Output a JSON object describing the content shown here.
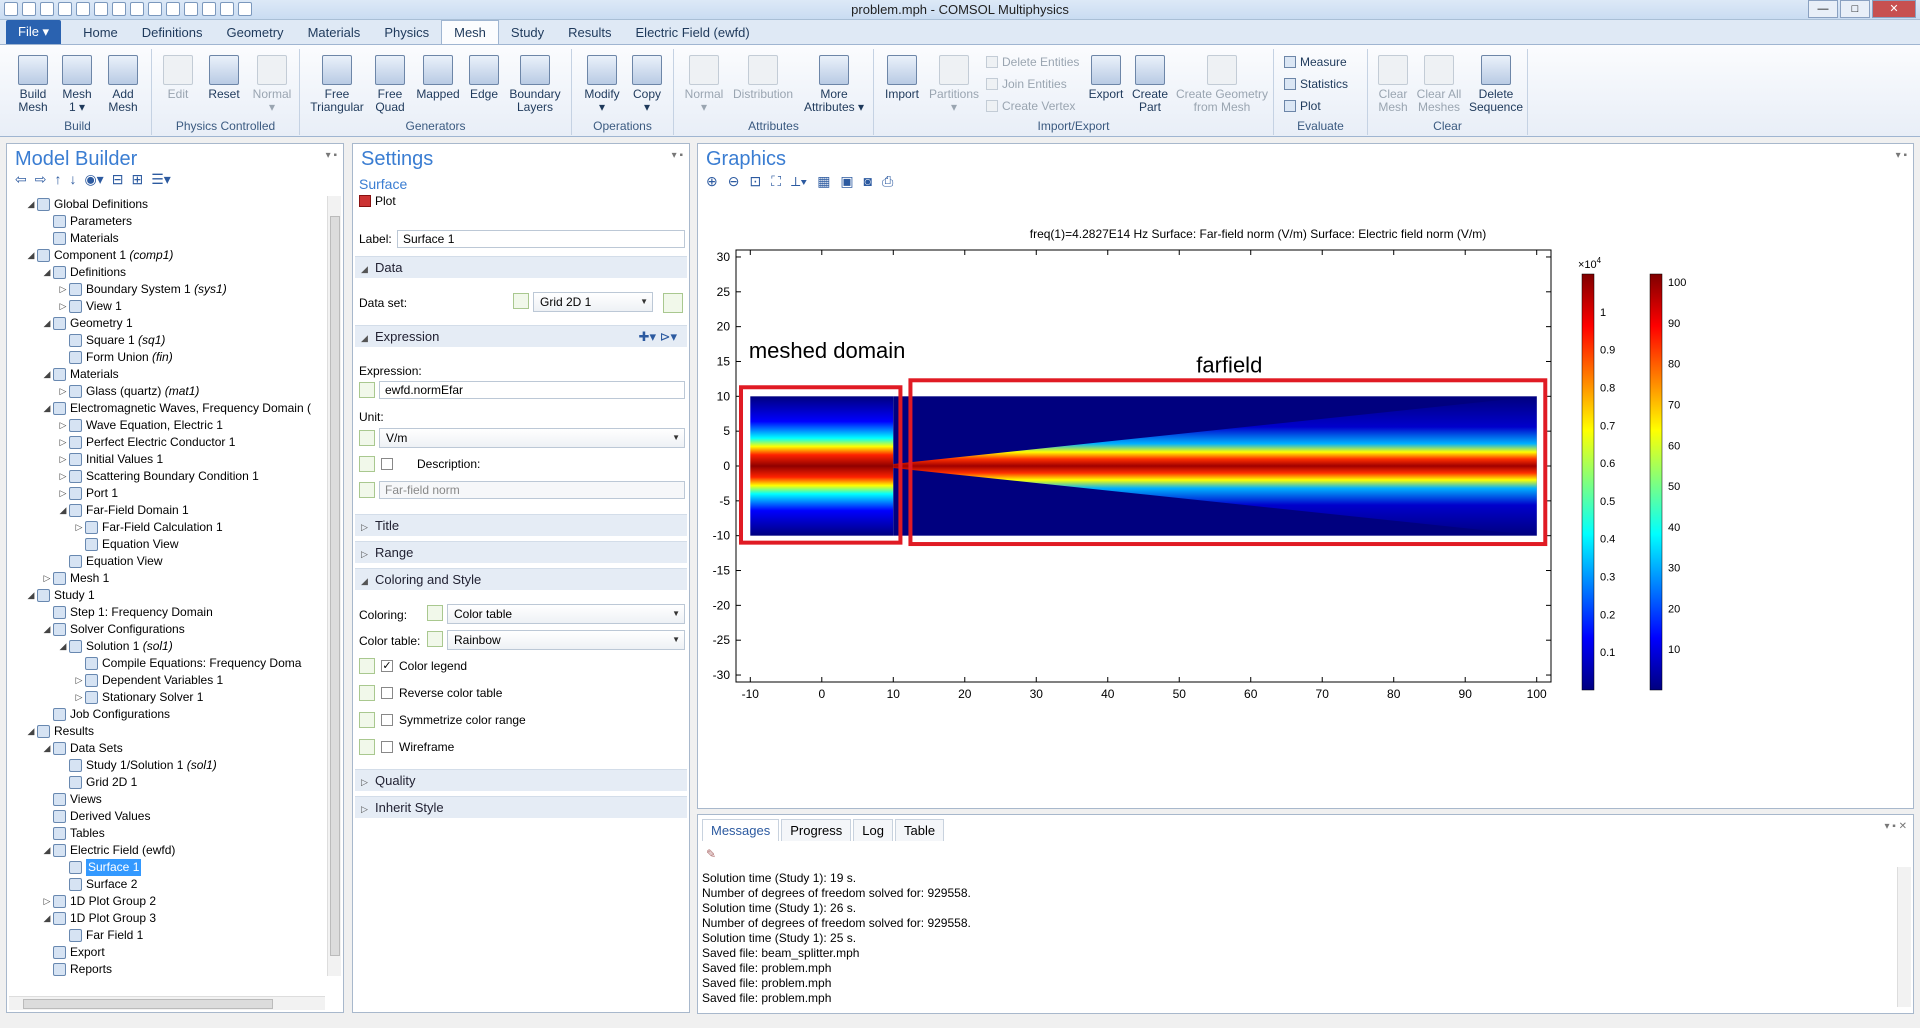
{
  "window": {
    "title": "problem.mph - COMSOL Multiphysics"
  },
  "ribbon_tabs": [
    "File ▾",
    "Home",
    "Definitions",
    "Geometry",
    "Materials",
    "Physics",
    "Mesh",
    "Study",
    "Results",
    "Electric Field (ewfd)"
  ],
  "active_tab": "Mesh",
  "ribbon": {
    "build": {
      "label": "Build",
      "build_mesh": "Build\nMesh",
      "mesh1": "Mesh\n1 ▾",
      "add_mesh": "Add\nMesh"
    },
    "physics_controlled": {
      "label": "Physics Controlled",
      "edit": "Edit",
      "reset": "Reset",
      "normal": "Normal\n▾"
    },
    "generators": {
      "label": "Generators",
      "free_triangular": "Free\nTriangular",
      "free_quad": "Free\nQuad",
      "mapped": "Mapped",
      "edge": "Edge",
      "boundary_layers": "Boundary\nLayers"
    },
    "operations": {
      "label": "Operations",
      "modify": "Modify\n▾",
      "copy": "Copy\n▾"
    },
    "attributes": {
      "label": "Attributes",
      "normal": "Normal\n▾",
      "distribution": "Distribution",
      "more_attributes": "More\nAttributes ▾"
    },
    "import_export": {
      "label": "Import/Export",
      "import": "Import",
      "partitions": "Partitions\n▾",
      "delete_entities": "Delete Entities",
      "join_entities": "Join Entities",
      "create_vertex": "Create Vertex",
      "export": "Export",
      "create_part": "Create\nPart",
      "create_geometry": "Create Geometry\nfrom Mesh"
    },
    "evaluate": {
      "label": "Evaluate",
      "measure": "Measure",
      "statistics": "Statistics",
      "plot": "Plot"
    },
    "clear": {
      "label": "Clear",
      "clear_mesh": "Clear\nMesh",
      "clear_all": "Clear All\nMeshes",
      "delete_sequence": "Delete\nSequence"
    }
  },
  "model_builder": {
    "title": "Model Builder",
    "tree": [
      {
        "d": 1,
        "t": "Global Definitions",
        "exp": "◢"
      },
      {
        "d": 2,
        "t": "Parameters",
        "exp": ""
      },
      {
        "d": 2,
        "t": "Materials",
        "exp": ""
      },
      {
        "d": 1,
        "t": "Component 1",
        "it": "(comp1)",
        "exp": "◢"
      },
      {
        "d": 2,
        "t": "Definitions",
        "exp": "◢"
      },
      {
        "d": 3,
        "t": "Boundary System 1",
        "it": "(sys1)",
        "exp": "▷"
      },
      {
        "d": 3,
        "t": "View 1",
        "exp": "▷"
      },
      {
        "d": 2,
        "t": "Geometry 1",
        "exp": "◢"
      },
      {
        "d": 3,
        "t": "Square 1",
        "it": "(sq1)",
        "exp": ""
      },
      {
        "d": 3,
        "t": "Form Union",
        "it": "(fin)",
        "exp": ""
      },
      {
        "d": 2,
        "t": "Materials",
        "exp": "◢"
      },
      {
        "d": 3,
        "t": "Glass (quartz)",
        "it": "(mat1)",
        "exp": "▷"
      },
      {
        "d": 2,
        "t": "Electromagnetic Waves, Frequency Domain (",
        "exp": "◢"
      },
      {
        "d": 3,
        "t": "Wave Equation, Electric 1",
        "exp": "▷"
      },
      {
        "d": 3,
        "t": "Perfect Electric Conductor 1",
        "exp": "▷"
      },
      {
        "d": 3,
        "t": "Initial Values 1",
        "exp": "▷"
      },
      {
        "d": 3,
        "t": "Scattering Boundary Condition 1",
        "exp": "▷"
      },
      {
        "d": 3,
        "t": "Port 1",
        "exp": "▷"
      },
      {
        "d": 3,
        "t": "Far-Field Domain 1",
        "exp": "◢"
      },
      {
        "d": 4,
        "t": "Far-Field Calculation 1",
        "exp": "▷"
      },
      {
        "d": 4,
        "t": "Equation View",
        "exp": ""
      },
      {
        "d": 3,
        "t": "Equation View",
        "exp": ""
      },
      {
        "d": 2,
        "t": "Mesh 1",
        "exp": "▷"
      },
      {
        "d": 1,
        "t": "Study 1",
        "exp": "◢"
      },
      {
        "d": 2,
        "t": "Step 1: Frequency Domain",
        "exp": ""
      },
      {
        "d": 2,
        "t": "Solver Configurations",
        "exp": "◢"
      },
      {
        "d": 3,
        "t": "Solution 1",
        "it": "(sol1)",
        "exp": "◢"
      },
      {
        "d": 4,
        "t": "Compile Equations: Frequency Doma",
        "exp": ""
      },
      {
        "d": 4,
        "t": "Dependent Variables 1",
        "exp": "▷"
      },
      {
        "d": 4,
        "t": "Stationary Solver 1",
        "exp": "▷"
      },
      {
        "d": 2,
        "t": "Job Configurations",
        "exp": ""
      },
      {
        "d": 1,
        "t": "Results",
        "exp": "◢"
      },
      {
        "d": 2,
        "t": "Data Sets",
        "exp": "◢"
      },
      {
        "d": 3,
        "t": "Study 1/Solution 1",
        "it": "(sol1)",
        "exp": ""
      },
      {
        "d": 3,
        "t": "Grid 2D 1",
        "exp": ""
      },
      {
        "d": 2,
        "t": "Views",
        "exp": ""
      },
      {
        "d": 2,
        "t": "Derived Values",
        "exp": ""
      },
      {
        "d": 2,
        "t": "Tables",
        "exp": ""
      },
      {
        "d": 2,
        "t": "Electric Field (ewfd)",
        "exp": "◢"
      },
      {
        "d": 3,
        "t": "Surface 1",
        "exp": "",
        "sel": true
      },
      {
        "d": 3,
        "t": "Surface 2",
        "exp": ""
      },
      {
        "d": 2,
        "t": "1D Plot Group 2",
        "exp": "▷"
      },
      {
        "d": 2,
        "t": "1D Plot Group 3",
        "exp": "◢"
      },
      {
        "d": 3,
        "t": "Far Field 1",
        "exp": ""
      },
      {
        "d": 2,
        "t": "Export",
        "exp": ""
      },
      {
        "d": 2,
        "t": "Reports",
        "exp": ""
      }
    ]
  },
  "settings": {
    "title": "Settings",
    "subtitle": "Surface",
    "plot_button": "Plot",
    "label_caption": "Label:",
    "label_value": "Surface 1",
    "sec_data": "Data",
    "dataset_caption": "Data set:",
    "dataset_value": "Grid 2D 1",
    "sec_expression": "Expression",
    "expression_caption": "Expression:",
    "expression_value": "ewfd.normEfar",
    "unit_caption": "Unit:",
    "unit_value": "V/m",
    "description_caption": "Description:",
    "description_value": "Far-field norm",
    "sec_title": "Title",
    "sec_range": "Range",
    "sec_coloring": "Coloring and Style",
    "coloring_caption": "Coloring:",
    "coloring_value": "Color table",
    "colortable_caption": "Color table:",
    "colortable_value": "Rainbow",
    "color_legend": "Color legend",
    "reverse_color_table": "Reverse color table",
    "symmetrize": "Symmetrize color range",
    "wireframe": "Wireframe",
    "sec_quality": "Quality",
    "sec_inherit": "Inherit Style"
  },
  "graphics": {
    "title": "Graphics",
    "plot_title": "freq(1)=4.2827E14 Hz   Surface: Far-field norm (V/m)  Surface: Electric field norm (V/m)",
    "annotation_meshed": "meshed domain",
    "annotation_farfield": "farfield",
    "colorbar1_exponent": "×10",
    "colorbar1_exp_sup": "4",
    "colors": {
      "annotation_box": "#e01b24",
      "background": "#ffffff"
    }
  },
  "chart_data": {
    "type": "heatmap",
    "title": "freq(1)=4.2827E14 Hz   Surface: Far-field norm (V/m)  Surface: Electric field norm (V/m)",
    "xlim": [
      -12,
      102
    ],
    "ylim": [
      -31,
      31
    ],
    "x_ticks": [
      -10,
      0,
      10,
      20,
      30,
      40,
      50,
      60,
      70,
      80,
      90,
      100
    ],
    "y_ticks": [
      30,
      25,
      20,
      15,
      10,
      5,
      0,
      -5,
      -10,
      -15,
      -20,
      -25,
      -30
    ],
    "regions": [
      {
        "name": "meshed domain",
        "x": [
          -10,
          10
        ],
        "y": [
          -10,
          10
        ],
        "field": "Electric field norm"
      },
      {
        "name": "farfield",
        "x": [
          10,
          100
        ],
        "y": [
          -10,
          10
        ],
        "field": "Far-field norm"
      }
    ],
    "colorbar_left": {
      "ticks": [
        1,
        0.9,
        0.8,
        0.7,
        0.6,
        0.5,
        0.4,
        0.3,
        0.2,
        0.1
      ],
      "scale": "×10^4",
      "colormap": "Rainbow"
    },
    "colorbar_right": {
      "ticks": [
        100,
        90,
        80,
        70,
        60,
        50,
        40,
        30,
        20,
        10
      ],
      "colormap": "Rainbow"
    }
  },
  "messages": {
    "tabs": [
      "Messages",
      "Progress",
      "Log",
      "Table"
    ],
    "lines": [
      "Solution time (Study 1): 19 s.",
      "Number of degrees of freedom solved for: 929558.",
      "Solution time (Study 1): 26 s.",
      "Number of degrees of freedom solved for: 929558.",
      "Solution time (Study 1): 25 s.",
      "Saved file: beam_splitter.mph",
      "Saved file: problem.mph",
      "Saved file: problem.mph",
      "Saved file: problem.mph"
    ]
  }
}
